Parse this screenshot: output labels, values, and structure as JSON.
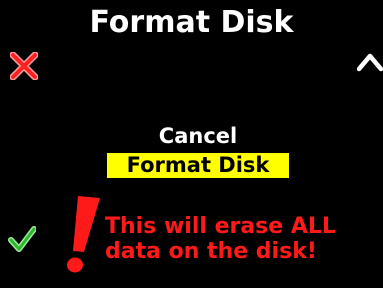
{
  "screen": {
    "title": "Format Disk",
    "background_color": "#000000"
  },
  "corners": {
    "top_left_icon": "cancel-x-icon",
    "top_right_icon": "up-arrow-icon",
    "bottom_left_icon": "checkmark-icon"
  },
  "menu": {
    "options": [
      {
        "label": "Cancel",
        "selected": false
      },
      {
        "label": "Format Disk",
        "selected": true
      }
    ],
    "highlight_color": "#ffff00"
  },
  "warning": {
    "icon": "exclamation-icon",
    "line1": "This will erase ALL",
    "line2": "data on the disk!",
    "color": "#ff1a1a"
  }
}
